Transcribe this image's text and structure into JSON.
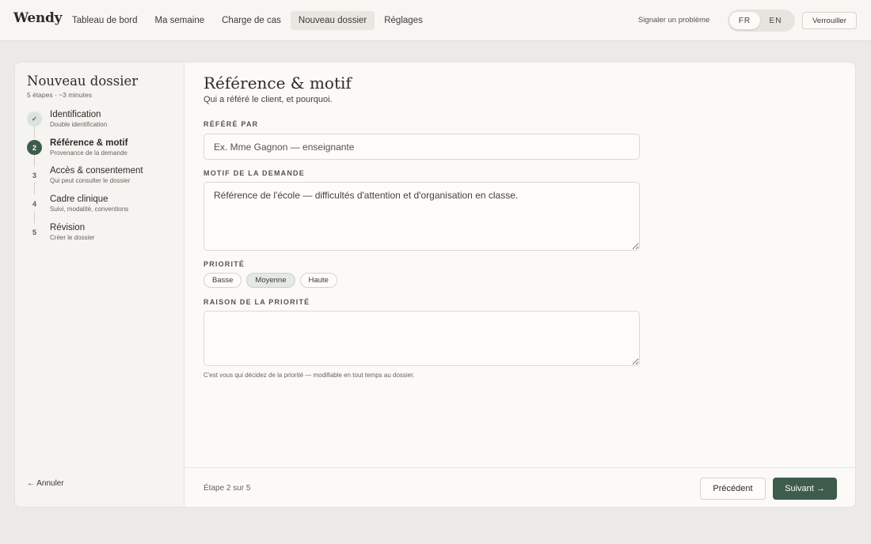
{
  "app": {
    "logo": "Wendy"
  },
  "nav": [
    {
      "label": "Tableau de bord",
      "active": false
    },
    {
      "label": "Ma semaine",
      "active": false
    },
    {
      "label": "Charge de cas",
      "active": false
    },
    {
      "label": "Nouveau dossier",
      "active": true
    },
    {
      "label": "Réglages",
      "active": false
    }
  ],
  "header": {
    "report_label": "Signaler un problème",
    "lang_fr": "FR",
    "lang_en": "EN",
    "active_lang": "FR",
    "lock_label": "Verrouiller"
  },
  "sidebar": {
    "title": "Nouveau dossier",
    "subtitle": "5 étapes · ~3 minutes",
    "steps": [
      {
        "marker": "✓",
        "label": "Identification",
        "desc": "Double identification",
        "state": "done"
      },
      {
        "marker": "2",
        "label": "Référence & motif",
        "desc": "Provenance de la demande",
        "state": "current"
      },
      {
        "marker": "3",
        "label": "Accès & consentement",
        "desc": "Qui peut consulter le dossier",
        "state": "todo"
      },
      {
        "marker": "4",
        "label": "Cadre clinique",
        "desc": "Suivi, modalité, conventions",
        "state": "todo"
      },
      {
        "marker": "5",
        "label": "Révision",
        "desc": "Créer le dossier",
        "state": "todo"
      }
    ],
    "cancel_label": "← Annuler"
  },
  "main": {
    "title": "Référence & motif",
    "subtitle": "Qui a référé le client, et pourquoi.",
    "referred_by": {
      "label": "RÉFÉRÉ PAR",
      "placeholder": "Ex. Mme Gagnon — enseignante",
      "value": ""
    },
    "reason": {
      "label": "MOTIF DE LA DEMANDE",
      "value": "Référence de l'école — difficultés d'attention et d'organisation en classe."
    },
    "priority": {
      "label": "PRIORITÉ",
      "options": [
        "Basse",
        "Moyenne",
        "Haute"
      ],
      "selected": "Moyenne"
    },
    "priority_reason": {
      "label": "RAISON DE LA PRIORITÉ",
      "value": ""
    },
    "hint": "C'est vous qui décidez de la priorité — modifiable en tout temps au dossier."
  },
  "footer": {
    "step_count": "Étape 2 sur 5",
    "prev_label": "Précédent",
    "next_label": "Suivant →"
  },
  "colors": {
    "accent": "#3e5c4b",
    "background": "#eceae6",
    "card": "#fbfaf7"
  }
}
